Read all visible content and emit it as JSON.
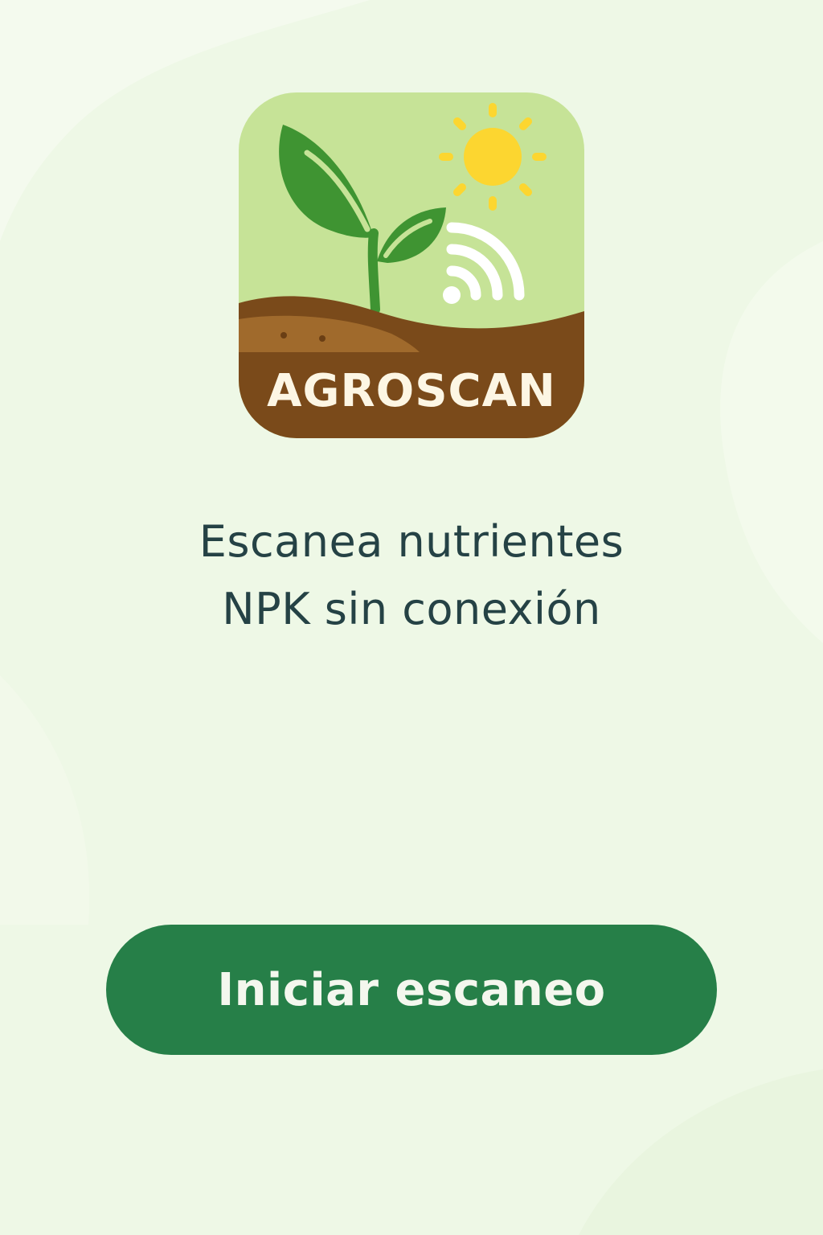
{
  "app": {
    "logo_text": "AGROSCAN",
    "logo_icon": "sprout-sun-signal-icon"
  },
  "main": {
    "tagline_line1": "Escanea nutrientes",
    "tagline_line2": "NPK sin conexión"
  },
  "actions": {
    "start_label": "Iniciar escaneo"
  },
  "colors": {
    "background": "#eef8e6",
    "accent": "#267f48",
    "text": "#254245",
    "soil": "#7a4a1a",
    "sun": "#fcd630",
    "leaf": "#3f9432",
    "icon_sky": "#c6e397"
  }
}
